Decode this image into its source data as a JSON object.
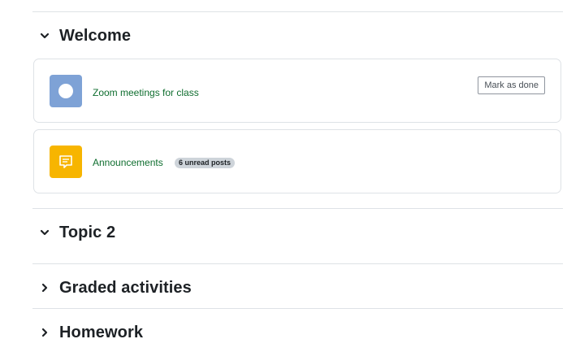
{
  "sections": [
    {
      "title": "Welcome",
      "expanded": true,
      "toggle_icon": "chevron-down-icon",
      "activities": [
        {
          "name": "Zoom meetings for class",
          "icon": "zoom-icon",
          "icon_color": "#7ea2d6",
          "action_label": "Mark as done"
        },
        {
          "name": "Announcements",
          "icon": "forum-icon",
          "icon_color": "#f7b500",
          "badge": "6 unread posts"
        }
      ]
    },
    {
      "title": "Topic 2",
      "expanded": true,
      "toggle_icon": "chevron-down-icon"
    },
    {
      "title": "Graded activities",
      "expanded": false,
      "toggle_icon": "chevron-right-icon"
    },
    {
      "title": "Homework",
      "expanded": false,
      "toggle_icon": "chevron-right-icon"
    }
  ],
  "colors": {
    "link": "#0f6e2f",
    "border": "#dee2e6",
    "title": "#1d2125"
  }
}
